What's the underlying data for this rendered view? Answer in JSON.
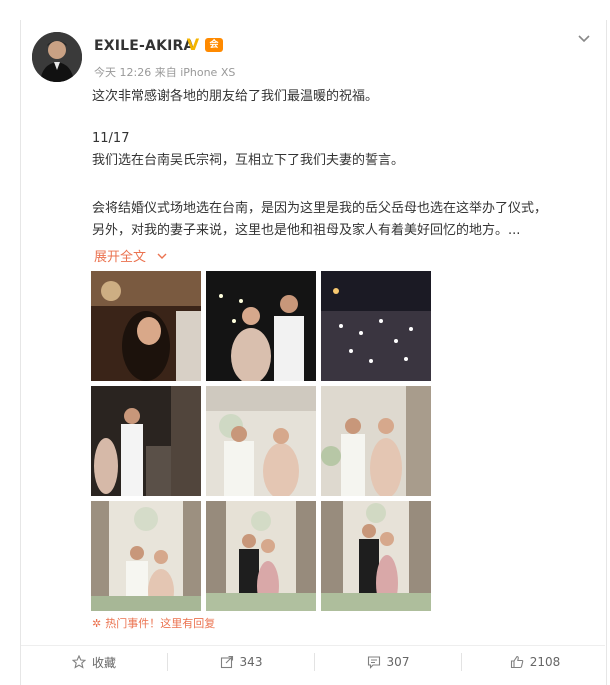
{
  "post": {
    "username": "EXILE-AKIRA",
    "verified_mark": "V",
    "level_badge": "会",
    "meta": "今天 12:26 来自 iPhone XS",
    "lines": [
      "这次非常感谢各地的朋友给了我们最温暖的祝福。",
      "11/17",
      "我们选在台南吴氏宗祠，互相立下了我们夫妻的誓言。",
      "会将结婚仪式场地选在台南，是因为这里是我的岳父岳母也选在这举办了仪式，",
      "另外，对我的妻子来说，这里也是他和祖母及家人有着美好回忆的地方。..."
    ],
    "expand_label": "展开全文",
    "hot_event": "热门事件！这里有回复"
  },
  "actions": {
    "favorite_label": "收藏",
    "repost_count": "343",
    "comment_count": "307",
    "like_count": "2108"
  },
  "icons": {
    "menu": "chevron-down-icon",
    "favorite": "star-icon",
    "repost": "share-icon",
    "comment": "comment-icon",
    "like": "thumbs-up-icon",
    "hot": "sparkle-icon"
  },
  "colors": {
    "accent": "#eb7350",
    "verified": "#f4b400",
    "text": "#333333",
    "meta": "#999999"
  }
}
